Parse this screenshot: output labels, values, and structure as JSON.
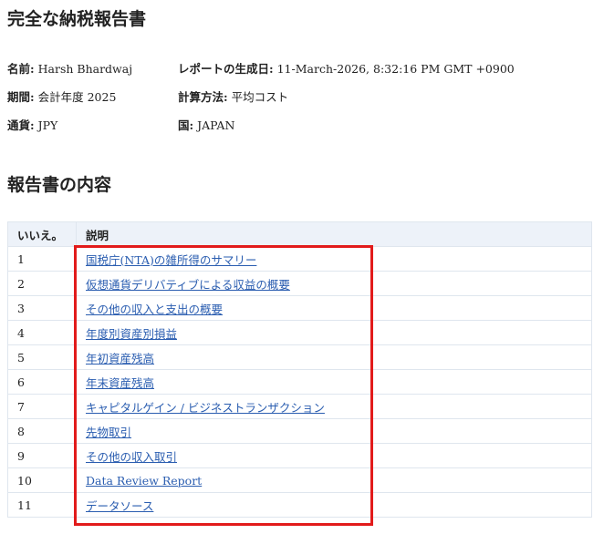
{
  "report": {
    "title": "完全な納税報告書",
    "name_label": "名前:",
    "name_value": "Harsh Bhardwaj",
    "generated_label": "レポートの生成日:",
    "generated_value": "11-March-2026,  8:32:16 PM GMT +0900",
    "period_label": "期間:",
    "period_value": "会計年度 2025",
    "method_label": "計算方法:",
    "method_value": "平均コスト",
    "currency_label": "通貨:",
    "currency_value": "JPY",
    "country_label": "国:",
    "country_value": "JAPAN"
  },
  "contents": {
    "title": "報告書の内容",
    "col_no": "いいえ。",
    "col_desc": "説明",
    "rows": [
      {
        "no": "1",
        "label": "国税庁(NTA)の雑所得のサマリー"
      },
      {
        "no": "2",
        "label": "仮想通貨デリバティブによる収益の概要"
      },
      {
        "no": "3",
        "label": "その他の収入と支出の概要"
      },
      {
        "no": "4",
        "label": "年度別資産別損益"
      },
      {
        "no": "5",
        "label": "年初資産残高"
      },
      {
        "no": "6",
        "label": "年末資産残高"
      },
      {
        "no": "7",
        "label": "キャピタルゲイン / ビジネストランザクション"
      },
      {
        "no": "8",
        "label": "先物取引"
      },
      {
        "no": "9",
        "label": "その他の収入取引"
      },
      {
        "no": "10",
        "label": "Data Review Report"
      },
      {
        "no": "11",
        "label": "データソース"
      }
    ]
  },
  "colors": {
    "link": "#2a5db0",
    "header_bg": "#edf2f9",
    "highlight": "#e21b1b"
  }
}
